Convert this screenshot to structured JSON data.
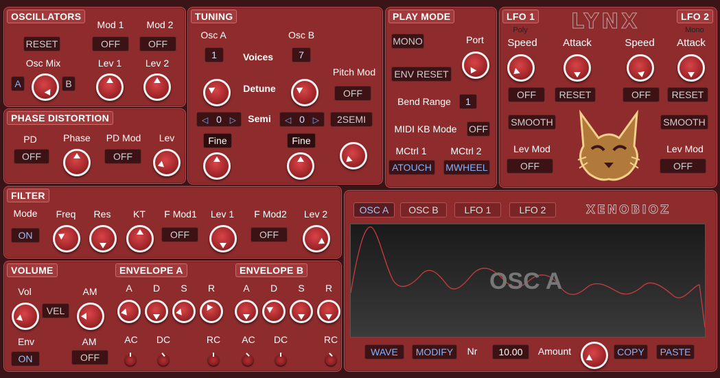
{
  "panels": {
    "oscillators": "OSCILLATORS",
    "tuning": "TUNING",
    "play_mode": "PLAY MODE",
    "lfo1": "LFO 1",
    "lfo2": "LFO 2",
    "phase_distortion": "PHASE DISTORTION",
    "filter": "FILTER",
    "volume": "VOLUME",
    "envelope_a": "ENVELOPE A",
    "envelope_b": "ENVELOPE B"
  },
  "oscillators": {
    "mod1": "Mod 1",
    "mod2": "Mod 2",
    "reset": "RESET",
    "mod1_val": "OFF",
    "mod2_val": "OFF",
    "osc_mix": "Osc Mix",
    "lev1": "Lev 1",
    "lev2": "Lev 2",
    "a": "A",
    "b": "B"
  },
  "tuning": {
    "osc_a": "Osc A",
    "osc_b": "Osc B",
    "voices": "Voices",
    "voices_a": "1",
    "voices_b": "7",
    "detune": "Detune",
    "pitch_mod": "Pitch Mod",
    "pitch_mod_val": "OFF",
    "semi": "Semi",
    "semi_a": "0",
    "semi_b": "0",
    "semi_mode": "2SEMI",
    "fine_a": "Fine",
    "fine_b": "Fine",
    "left_arrow": "◁",
    "right_arrow": "▷"
  },
  "play_mode": {
    "mono": "MONO",
    "port": "Port",
    "env_reset": "ENV RESET",
    "bend_range": "Bend Range",
    "bend_val": "1",
    "midi_kb_mode": "MIDI KB Mode",
    "midi_kb_val": "OFF",
    "mctrl1": "MCtrl 1",
    "mctrl2": "MCtrl 2",
    "mctrl1_val": "ATOUCH",
    "mctrl2_val": "MWHEEL"
  },
  "lfo": {
    "poly": "Poly",
    "mono": "Mono",
    "speed": "Speed",
    "attack": "Attack",
    "off": "OFF",
    "reset": "RESET",
    "smooth": "SMOOTH",
    "lev_mod": "Lev Mod",
    "lev_mod_val": "OFF",
    "logo": "LYNX"
  },
  "phase_distortion": {
    "pd": "PD",
    "phase": "Phase",
    "pd_mod": "PD Mod",
    "lev": "Lev",
    "pd_val": "OFF",
    "pd_mod_val": "OFF"
  },
  "filter": {
    "mode": "Mode",
    "mode_val": "ON",
    "freq": "Freq",
    "res": "Res",
    "kt": "KT",
    "fmod1": "F Mod1",
    "fmod1_val": "OFF",
    "lev1": "Lev 1",
    "fmod2": "F Mod2",
    "fmod2_val": "OFF",
    "lev2": "Lev 2"
  },
  "volume": {
    "vol": "Vol",
    "vel": "VEL",
    "am": "AM",
    "env": "Env",
    "env_val": "ON",
    "am2": "AM",
    "am_val": "OFF"
  },
  "envelope": {
    "a": "A",
    "d": "D",
    "s": "S",
    "r": "R",
    "ac": "AC",
    "dc": "DC",
    "rc": "RC"
  },
  "display": {
    "tabs": [
      "OSC A",
      "OSC B",
      "LFO 1",
      "LFO 2"
    ],
    "brand": "XENOBIOZ",
    "screen_label": "OSC A",
    "wave": "WAVE",
    "modify": "MODIFY",
    "nr": "Nr",
    "nr_val": "10.00",
    "amount": "Amount",
    "copy": "COPY",
    "paste": "PASTE"
  },
  "colors": {
    "panel": "#8e2b2d",
    "background": "#3a1416",
    "accent_blue": "#7fb3ff",
    "waveform": "#c83c40"
  }
}
